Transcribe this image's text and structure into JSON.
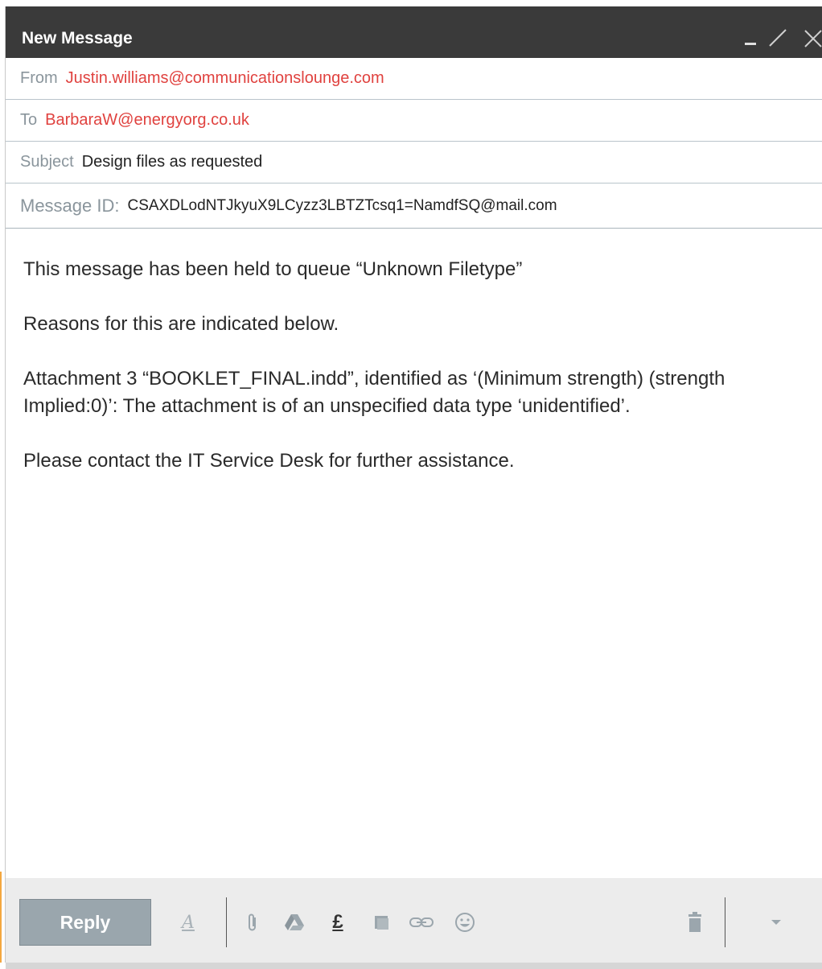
{
  "window": {
    "title": "New Message"
  },
  "fields": {
    "from": {
      "label": "From",
      "value": "Justin.williams@communicationslounge.com"
    },
    "to": {
      "label": "To",
      "value": "BarbaraW@energyorg.co.uk"
    },
    "subject": {
      "label": "Subject",
      "value": "Design files as requested"
    },
    "message_id": {
      "label": "Message ID:",
      "value": "CSAXDLodNTJkyuX9LCyzz3LBTZTcsq1=NamdfSQ@mail.com"
    }
  },
  "body": {
    "paragraphs": [
      "This message has been held to queue “Unknown Filetype”",
      "Reasons for this are indicated below.",
      "Attachment 3 “BOOKLET_FINAL.indd”, identified as ‘(Minimum strength) (strength Implied:0)’: The attachment is of an unspecified data type ‘unidentified’.",
      "Please contact the IT Service Desk for further assistance."
    ]
  },
  "toolbar": {
    "reply_label": "Reply",
    "format_icon_glyph": "A",
    "pound_glyph": "£",
    "icons": [
      "text-format-icon",
      "paperclip-icon",
      "drive-icon",
      "pound-icon",
      "copy-icon",
      "link-icon",
      "emoji-icon",
      "trash-icon",
      "more-options-icon"
    ]
  },
  "colors": {
    "titlebar": "#3a3a3a",
    "link_red": "#e0423f",
    "label_gray": "#8a959c",
    "reply_button": "#9aa6ad",
    "toolbar_bg": "#ececec",
    "accent": "#f4a740"
  }
}
